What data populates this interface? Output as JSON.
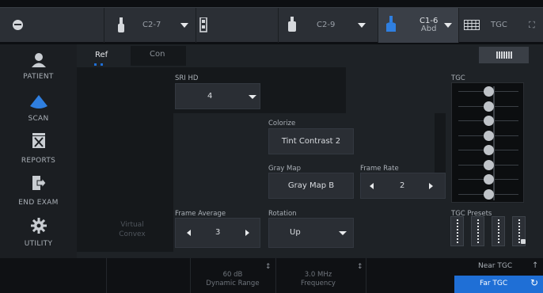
{
  "probes": [
    {
      "label": "C2-7"
    },
    {
      "label": "C2-9"
    },
    {
      "label_line1": "C1-6",
      "label_line2": "Abd"
    },
    {
      "label": "TGC"
    }
  ],
  "sidebar": {
    "items": [
      {
        "label": "PATIENT"
      },
      {
        "label": "SCAN"
      },
      {
        "label": "REPORTS"
      },
      {
        "label": "END EXAM"
      },
      {
        "label": "UTILITY"
      }
    ]
  },
  "tabs": [
    {
      "label": "Ref"
    },
    {
      "label": "Con"
    }
  ],
  "controls": {
    "sri_hd": {
      "label": "SRI HD",
      "value": "4"
    },
    "colorize": {
      "label": "Colorize",
      "value": "Tint Contrast 2"
    },
    "gray_map": {
      "label": "Gray Map",
      "value": "Gray Map B"
    },
    "frame_rate": {
      "label": "Frame Rate",
      "value": "2"
    },
    "frame_average": {
      "label": "Frame Average",
      "value": "3"
    },
    "rotation": {
      "label": "Rotation",
      "value": "Up"
    },
    "virtual_convex": {
      "line1": "Virtual",
      "line2": "Convex"
    }
  },
  "tgc": {
    "label": "TGC",
    "presets_label": "TGC Presets",
    "knob_levels": [
      0.5,
      0.5,
      0.5,
      0.5,
      0.5,
      0.5,
      0.5,
      0.5
    ]
  },
  "bottom": {
    "dynamic_range": {
      "value": "60 dB",
      "label": "Dynamic Range"
    },
    "frequency": {
      "value": "3.0 MHz",
      "label": "Frequency"
    },
    "near_tgc": "Near TGC",
    "far_tgc": "Far TGC"
  },
  "colors": {
    "accent": "#1f6fd6",
    "scan_icon": "#2f7fe0"
  }
}
